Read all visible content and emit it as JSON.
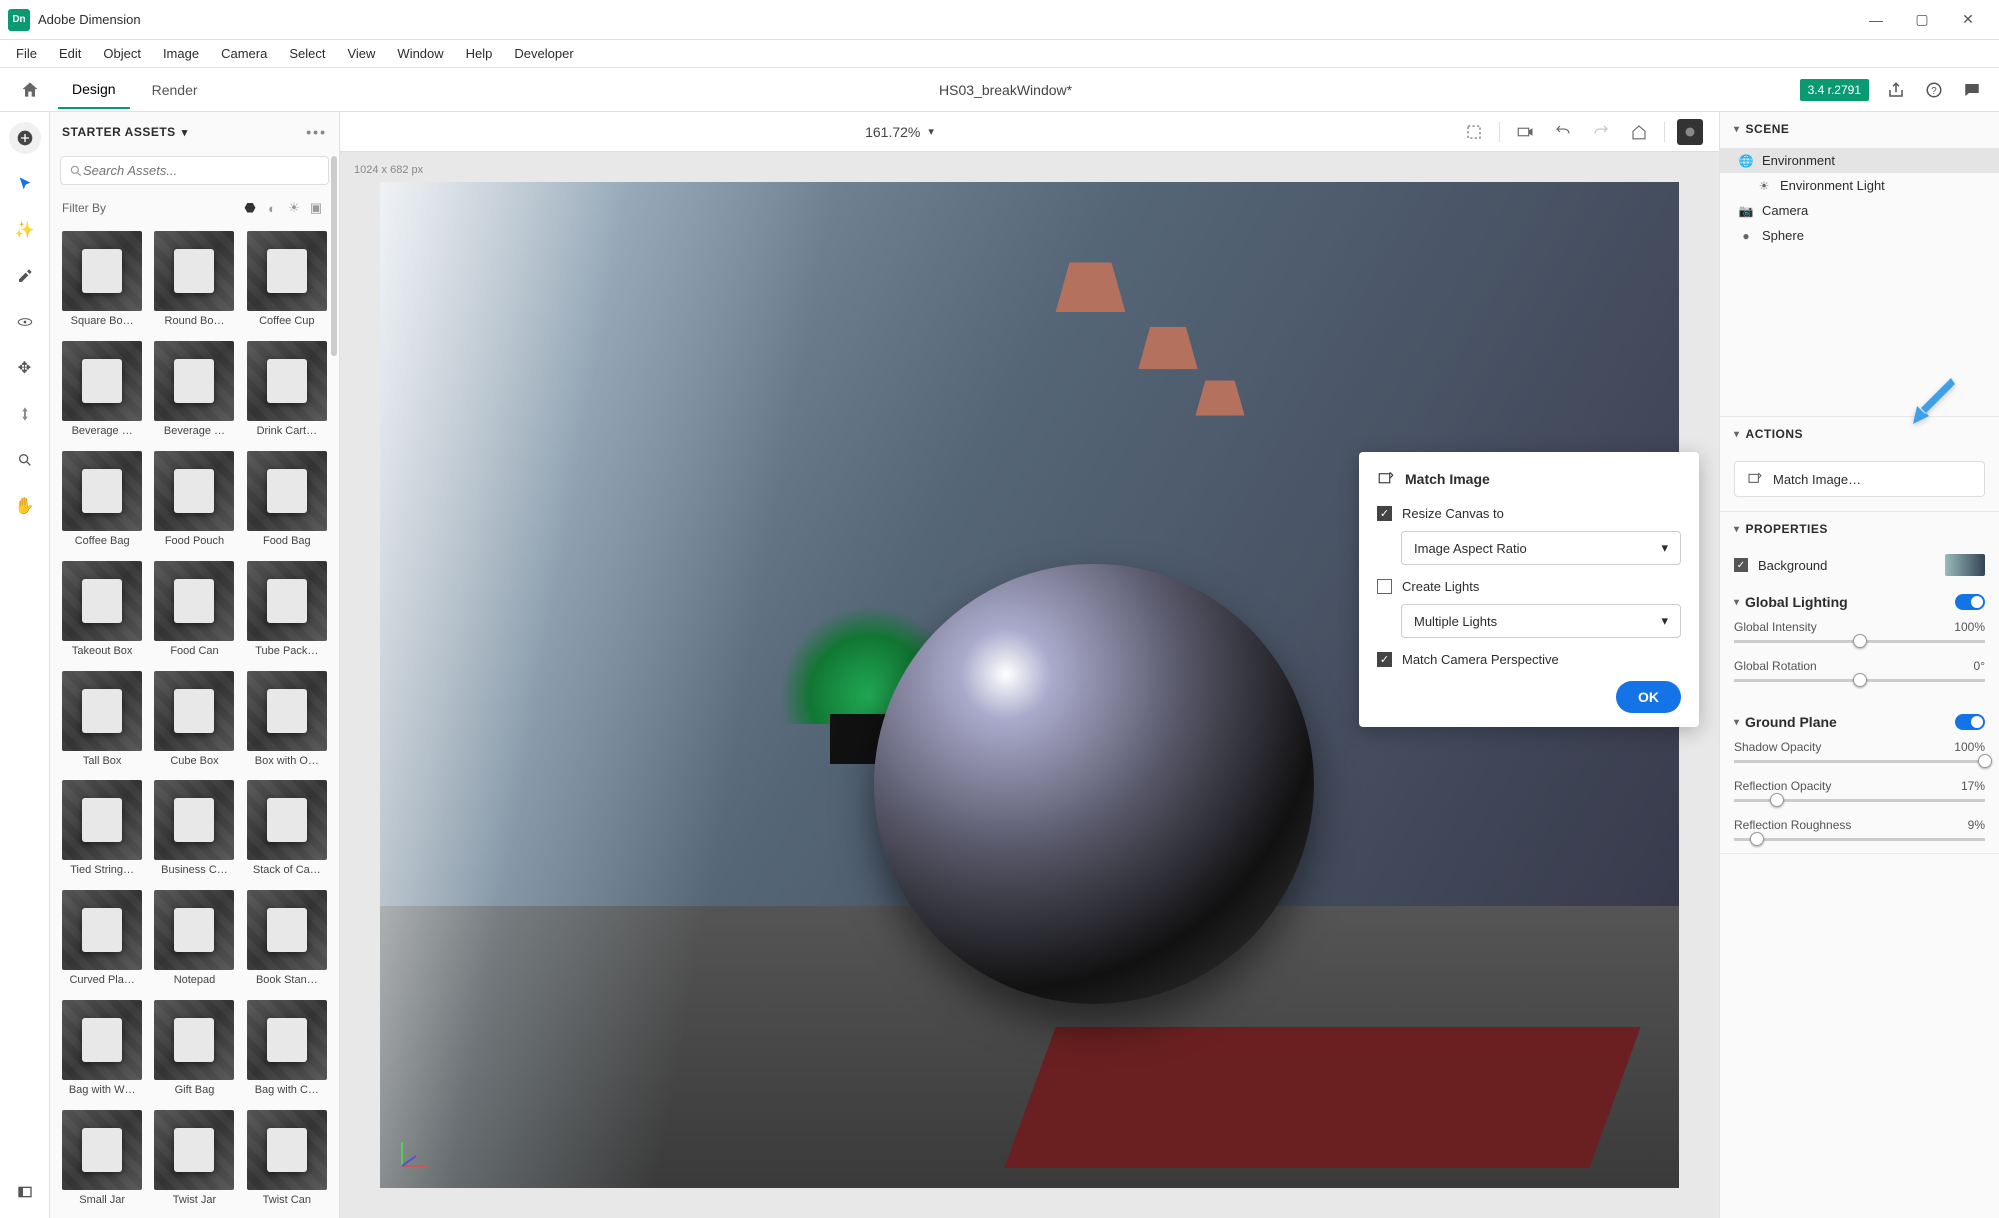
{
  "app": {
    "name": "Adobe Dimension"
  },
  "menu": [
    "File",
    "Edit",
    "Object",
    "Image",
    "Camera",
    "Select",
    "View",
    "Window",
    "Help",
    "Developer"
  ],
  "modes": {
    "design": "Design",
    "render": "Render"
  },
  "document": {
    "title": "HS03_breakWindow*"
  },
  "build": "3.4 r.2791",
  "assets_panel": {
    "title": "STARTER ASSETS",
    "search_placeholder": "Search Assets...",
    "filter_label": "Filter By",
    "items": [
      "Square Bo…",
      "Round Bo…",
      "Coffee Cup",
      "Beverage …",
      "Beverage …",
      "Drink Cart…",
      "Coffee Bag",
      "Food Pouch",
      "Food Bag",
      "Takeout Box",
      "Food Can",
      "Tube Pack…",
      "Tall Box",
      "Cube Box",
      "Box with O…",
      "Tied String…",
      "Business C…",
      "Stack of Ca…",
      "Curved Pla…",
      "Notepad",
      "Book Stan…",
      "Bag with W…",
      "Gift Bag",
      "Bag with C…",
      "Small Jar",
      "Twist Jar",
      "Twist Can"
    ]
  },
  "canvas": {
    "zoom": "161.72%",
    "dims": "1024 x 682 px"
  },
  "match_image": {
    "title": "Match Image",
    "resize_label": "Resize Canvas to",
    "resize_option": "Image Aspect Ratio",
    "create_lights_label": "Create Lights",
    "lights_option": "Multiple Lights",
    "camera_label": "Match Camera Perspective",
    "ok": "OK"
  },
  "scene": {
    "header": "SCENE",
    "items": [
      {
        "label": "Environment",
        "icon": "globe"
      },
      {
        "label": "Environment Light",
        "icon": "sun",
        "nested": true
      },
      {
        "label": "Camera",
        "icon": "camera"
      },
      {
        "label": "Sphere",
        "icon": "sphere"
      }
    ]
  },
  "actions": {
    "header": "ACTIONS",
    "match_image": "Match Image…"
  },
  "properties": {
    "header": "PROPERTIES",
    "background": "Background",
    "global_lighting": "Global Lighting",
    "global_intensity": {
      "label": "Global Intensity",
      "value": "100%"
    },
    "global_rotation": {
      "label": "Global Rotation",
      "value": "0°"
    },
    "ground_plane": "Ground Plane",
    "shadow_opacity": {
      "label": "Shadow Opacity",
      "value": "100%"
    },
    "reflection_opacity": {
      "label": "Reflection Opacity",
      "value": "17%"
    },
    "reflection_roughness": {
      "label": "Reflection Roughness",
      "value": "9%"
    }
  }
}
